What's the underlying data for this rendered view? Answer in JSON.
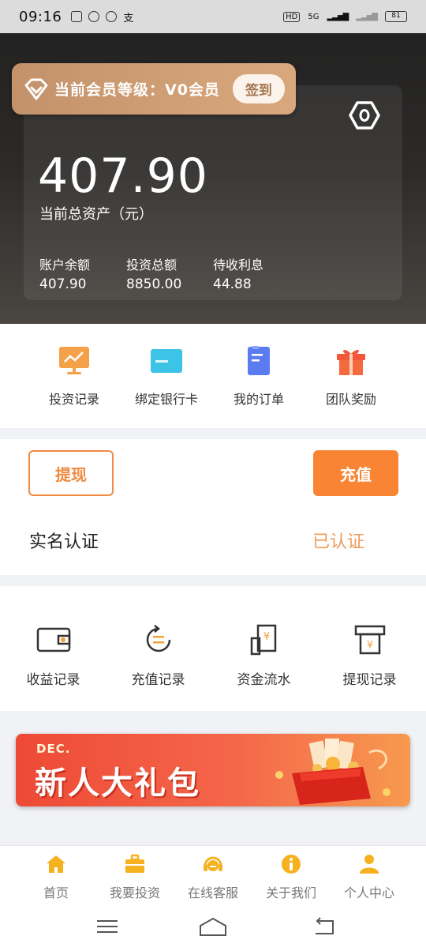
{
  "status_bar": {
    "time": "09:16",
    "network": "5G",
    "signal_badge": "HD",
    "battery": "81"
  },
  "vip": {
    "level_text": "当前会员等级：V0会员",
    "sign_in_label": "签到"
  },
  "assets": {
    "total": "407.90",
    "total_label": "当前总资产（元）",
    "stats": [
      {
        "label": "账户余额",
        "value": "407.90"
      },
      {
        "label": "投资总额",
        "value": "8850.00"
      },
      {
        "label": "待收利息",
        "value": "44.88"
      }
    ]
  },
  "quick_menu": [
    {
      "label": "投资记录",
      "icon": "investment-chart-icon"
    },
    {
      "label": "绑定银行卡",
      "icon": "bank-card-icon"
    },
    {
      "label": "我的订单",
      "icon": "order-document-icon"
    },
    {
      "label": "团队奖励",
      "icon": "gift-box-icon"
    }
  ],
  "actions": {
    "withdraw_label": "提现",
    "recharge_label": "充值"
  },
  "verification": {
    "label": "实名认证",
    "status": "已认证"
  },
  "records": [
    {
      "label": "收益记录",
      "icon": "wallet-icon"
    },
    {
      "label": "充值记录",
      "icon": "recharge-cycle-icon"
    },
    {
      "label": "资金流水",
      "icon": "fund-flow-icon"
    },
    {
      "label": "提现记录",
      "icon": "withdraw-record-icon"
    }
  ],
  "promo": {
    "tag": "DEC.",
    "title": "新人大礼包"
  },
  "tabbar": [
    {
      "label": "首页",
      "icon": "home-icon"
    },
    {
      "label": "我要投资",
      "icon": "briefcase-icon"
    },
    {
      "label": "在线客服",
      "icon": "headset-icon"
    },
    {
      "label": "关于我们",
      "icon": "info-icon"
    },
    {
      "label": "个人中心",
      "icon": "user-icon"
    }
  ],
  "colors": {
    "accent": "#f88434",
    "tab_icon": "#f6b11f",
    "vip_gold": "#c3926a"
  }
}
